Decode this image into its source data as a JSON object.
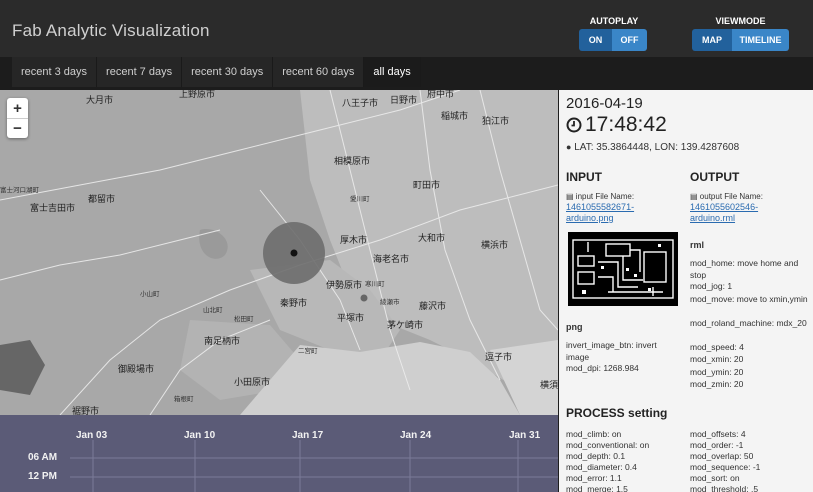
{
  "header": {
    "title": "Fab Analytic Visualization",
    "autoplay": {
      "label": "AUTOPLAY",
      "on": "ON",
      "off": "OFF",
      "selected": "ON"
    },
    "viewmode": {
      "label": "VIEWMODE",
      "map": "MAP",
      "timeline": "TIMELINE",
      "selected": "MAP"
    }
  },
  "tabs": [
    {
      "label": "recent 3 days",
      "active": false
    },
    {
      "label": "recent 7 days",
      "active": false
    },
    {
      "label": "recent 30 days",
      "active": false
    },
    {
      "label": "recent 60 days",
      "active": false
    },
    {
      "label": "all days",
      "active": true
    }
  ],
  "map": {
    "zoom_in": "+",
    "zoom_out": "−",
    "places": [
      "大月市",
      "上野原市",
      "八王子市",
      "日野市",
      "府中市",
      "稲城市",
      "狛江市",
      "相模原市",
      "町田市",
      "富士河口湖町",
      "都留市",
      "富士吉田市",
      "厚木市",
      "大和市",
      "横浜市",
      "海老名市",
      "伊勢原市",
      "綾瀬市",
      "藤沢市",
      "秦野市",
      "平塚市",
      "茅ケ崎市",
      "小山町",
      "山北町",
      "松田町",
      "南足柄市",
      "二宮町",
      "御殿場市",
      "小田原市",
      "逗子市",
      "横須賀",
      "裾野市",
      "箱根町",
      "寒川町",
      "愛川町"
    ]
  },
  "timeline": {
    "dates": [
      "Jan 03",
      "Jan 10",
      "Jan 17",
      "Jan 24",
      "Jan 31"
    ],
    "times": [
      "06 AM",
      "12 PM"
    ]
  },
  "panel": {
    "date": "2016-04-19",
    "time": "17:48:42",
    "location": "LAT: 35.3864448, LON: 139.4287608",
    "input": {
      "heading": "INPUT",
      "file_label": "input File Name:",
      "file_name": "1461055582671-arduino.png",
      "type": "png",
      "params": [
        "invert_image_btn: invert image",
        "mod_dpi: 1268.984"
      ]
    },
    "output": {
      "heading": "OUTPUT",
      "file_label": "output File Name:",
      "file_name": "1461055602546-arduino.rml",
      "type": "rml",
      "params": [
        "mod_home: move home and stop",
        "mod_jog: 1",
        "mod_move: move to xmin,ymin",
        "mod_roland_machine: mdx_20",
        "mod_speed: 4",
        "mod_xmin: 20",
        "mod_ymin: 20",
        "mod_zmin: 20"
      ]
    },
    "process": {
      "heading": "PROCESS setting",
      "left": [
        "mod_climb: on",
        "mod_conventional: on",
        "mod_depth: 0.1",
        "mod_diameter: 0.4",
        "mod_error: 1.1",
        "mod_merge: 1.5"
      ],
      "right": [
        "mod_offsets: 4",
        "mod_order: -1",
        "mod_overlap: 50",
        "mod_sequence: -1",
        "mod_sort: on",
        "mod_threshold: .5"
      ]
    }
  }
}
